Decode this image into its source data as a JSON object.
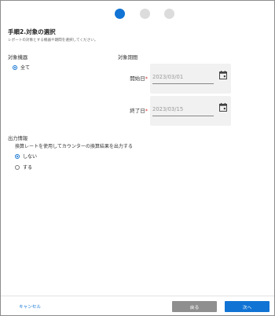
{
  "stepper": {
    "total": 3,
    "current": 1
  },
  "header": {
    "title": "手順2.対象の選択",
    "subtitle": "レポートの対象とする機器や期間を選択してください。"
  },
  "target_device": {
    "label": "対象機器",
    "option_all": "全て"
  },
  "target_period": {
    "label": "対象期間",
    "start": {
      "label": "開始日",
      "required_mark": "*",
      "value": "2023/03/01",
      "icon": "calendar-icon"
    },
    "end": {
      "label": "終了日",
      "required_mark": "*",
      "value": "2023/03/15",
      "icon": "calendar-icon"
    }
  },
  "output_info": {
    "label": "出力情報",
    "question": "換算レートを使用してカウンターの換算結果を出力する",
    "options": [
      {
        "label": "しない",
        "selected": true
      },
      {
        "label": "する",
        "selected": false
      }
    ]
  },
  "footer": {
    "cancel_label": "キャンセル",
    "back_label": "戻る",
    "next_label": "次へ"
  },
  "colors": {
    "accent": "#1173d4",
    "required": "#d32f2f",
    "inactive_step": "#dcdcdc",
    "back_button": "#8f8f8f"
  }
}
